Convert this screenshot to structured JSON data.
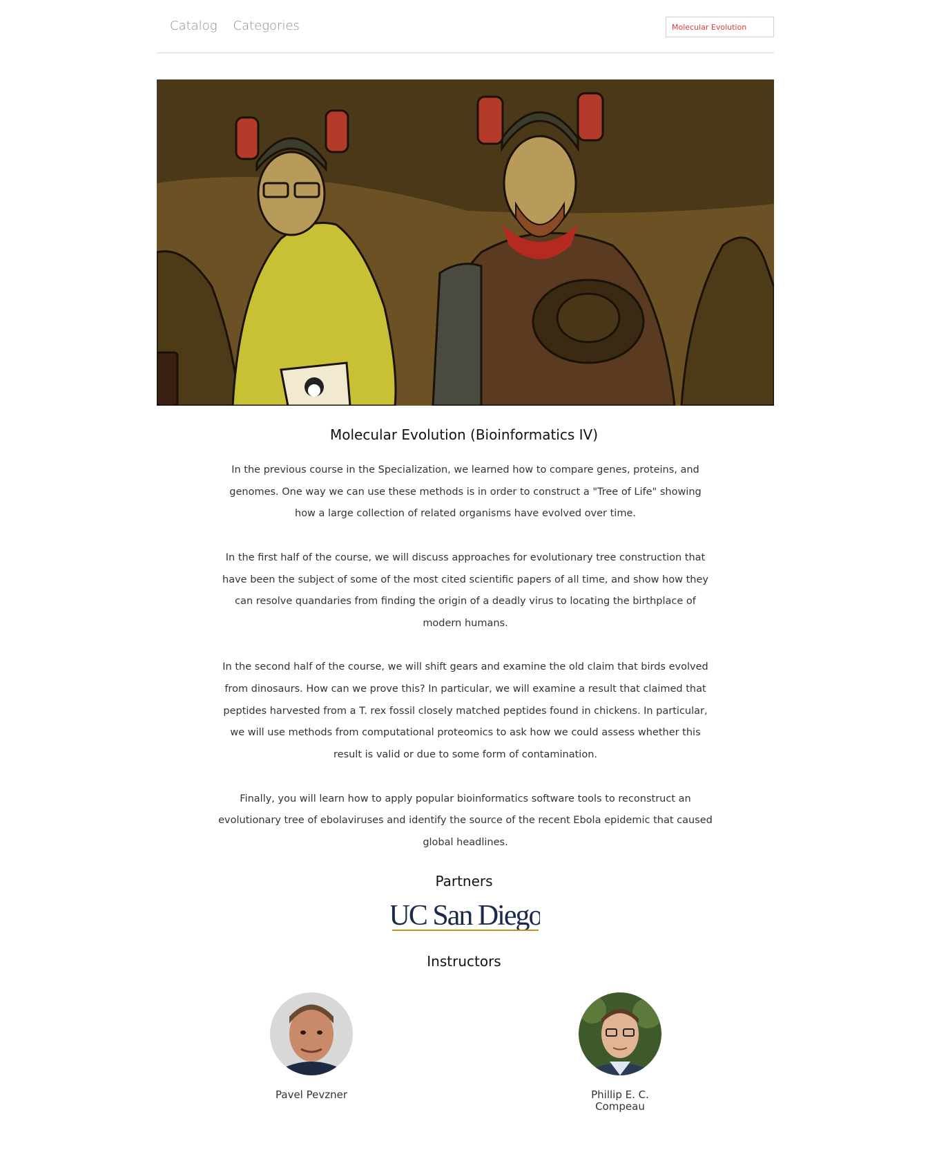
{
  "nav": {
    "catalog": "Catalog",
    "categories": "Categories"
  },
  "search": {
    "value": "Molecular Evolution"
  },
  "course": {
    "title": "Molecular Evolution (Bioinformatics IV)",
    "paragraphs": [
      "In the previous course in the Specialization, we learned how to compare genes, proteins, and genomes.  One way we can use these methods is in order to construct a \"Tree of Life\" showing how a large collection of related organisms have evolved over time.",
      "In the first half of the course, we will discuss approaches for evolutionary tree construction that have been the subject of some of the most cited scientific papers of all time, and show how they can resolve quandaries from finding the origin of a deadly virus to locating the birthplace of modern humans.",
      "In the second half of the course, we will shift gears and examine the old claim that birds evolved from dinosaurs.  How can we prove this?  In particular, we will examine a result that claimed that peptides harvested from a T. rex fossil closely matched peptides found in chickens. In particular, we will use methods from computational proteomics to ask how we could assess whether this result is valid or due to some form of contamination.",
      "Finally, you will learn how to apply popular bioinformatics software tools to reconstruct an evolutionary tree of ebolaviruses and identify the source of the recent Ebola epidemic that caused global headlines."
    ]
  },
  "partners": {
    "heading": "Partners",
    "logo_text": "UC San Diego"
  },
  "instructors": {
    "heading": "Instructors",
    "list": [
      {
        "name": "Pavel  Pevzner"
      },
      {
        "name": "Phillip E. C.\nCompeau"
      }
    ]
  },
  "colors": {
    "search_text": "#e03a3a",
    "ucsd_navy": "#182b49",
    "ucsd_gold": "#c69214"
  }
}
